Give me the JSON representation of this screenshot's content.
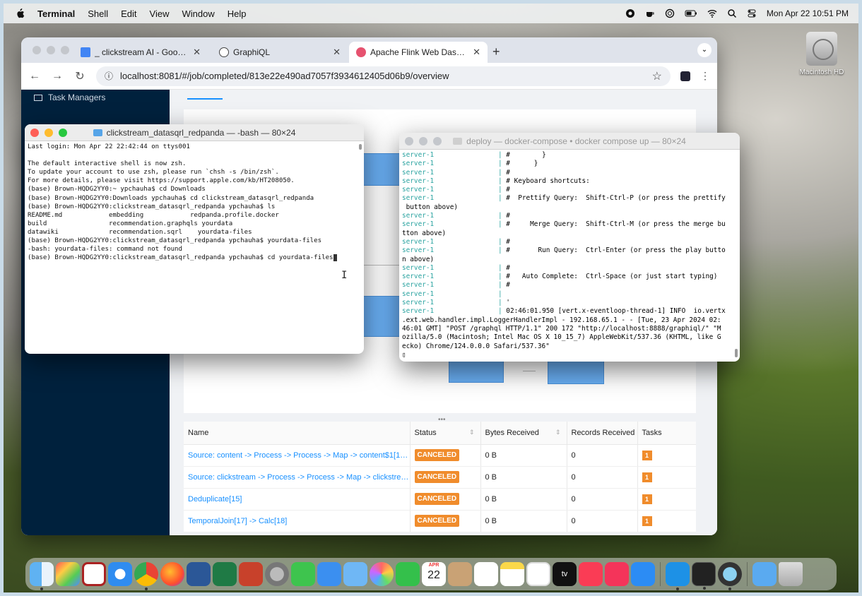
{
  "menubar": {
    "app": "Terminal",
    "items": [
      "Shell",
      "Edit",
      "View",
      "Window",
      "Help"
    ],
    "clock": "Mon Apr 22  10:51 PM"
  },
  "desktop": {
    "hd_label": "Macintosh HD"
  },
  "browser": {
    "tabs": [
      {
        "label": "_ clickstream AI - Google Do"
      },
      {
        "label": "GraphiQL"
      },
      {
        "label": "Apache Flink Web Dashboard"
      }
    ],
    "url": "localhost:8081/#/job/completed/813e22e490ad7057f3934612405d06b9/overview"
  },
  "flink": {
    "sidebar": {
      "task_managers": "Task Managers"
    },
    "table": {
      "headers": [
        "Name",
        "Status",
        "Bytes Received",
        "Records Received",
        "Tasks"
      ],
      "rows": [
        {
          "name": "Source: content -> Process -> Process -> Map -> content$1[1] ...",
          "status": "CANCELED",
          "bytes": "0 B",
          "records": "0",
          "tasks": "1"
        },
        {
          "name": "Source: clickstream -> Process -> Process -> Map -> clickstrea...",
          "status": "CANCELED",
          "bytes": "0 B",
          "records": "0",
          "tasks": "1"
        },
        {
          "name": "Deduplicate[15]",
          "status": "CANCELED",
          "bytes": "0 B",
          "records": "0",
          "tasks": "1"
        },
        {
          "name": "TemporalJoin[17] -> Calc[18]",
          "status": "CANCELED",
          "bytes": "0 B",
          "records": "0",
          "tasks": "1"
        }
      ]
    }
  },
  "terminal1": {
    "title": "clickstream_datasqrl_redpanda — -bash — 80×24",
    "lines": [
      "Last login: Mon Apr 22 22:42:44 on ttys001",
      "",
      "The default interactive shell is now zsh.",
      "To update your account to use zsh, please run `chsh -s /bin/zsh`.",
      "For more details, please visit https://support.apple.com/kb/HT208050.",
      "(base) Brown-HQDG2YY0:~ ypchauha$ cd Downloads",
      "(base) Brown-HQDG2YY0:Downloads ypchauha$ cd clickstream_datasqrl_redpanda",
      "(base) Brown-HQDG2YY0:clickstream_datasqrl_redpanda ypchauha$ ls",
      "README.md            embedding            redpanda.profile.docker",
      "build                recommendation.graphqls yourdata",
      "datawiki             recommendation.sqrl    yourdata-files",
      "(base) Brown-HQDG2YY0:clickstream_datasqrl_redpanda ypchauha$ yourdata-files",
      "-bash: yourdata-files: command not found",
      "(base) Brown-HQDG2YY0:clickstream_datasqrl_redpanda ypchauha$ cd yourdata-files"
    ]
  },
  "terminal2": {
    "title": "deploy — docker-compose • docker compose up — 80×24",
    "rows": [
      {
        "srv": "server-1",
        "text": "#        }"
      },
      {
        "srv": "server-1",
        "text": "#      }"
      },
      {
        "srv": "server-1",
        "text": "#"
      },
      {
        "srv": "server-1",
        "text": "# Keyboard shortcuts:"
      },
      {
        "srv": "server-1",
        "text": "#"
      },
      {
        "srv": "server-1",
        "text": "#  Prettify Query:  Shift-Ctrl-P (or press the prettify"
      },
      {
        "srv": "",
        "text": " button above)"
      },
      {
        "srv": "server-1",
        "text": "#"
      },
      {
        "srv": "server-1",
        "text": "#     Merge Query:  Shift-Ctrl-M (or press the merge bu"
      },
      {
        "srv": "",
        "text": "tton above)"
      },
      {
        "srv": "server-1",
        "text": "#"
      },
      {
        "srv": "server-1",
        "text": "#       Run Query:  Ctrl-Enter (or press the play butto"
      },
      {
        "srv": "",
        "text": "n above)"
      },
      {
        "srv": "server-1",
        "text": "#"
      },
      {
        "srv": "server-1",
        "text": "#   Auto Complete:  Ctrl-Space (or just start typing)"
      },
      {
        "srv": "server-1",
        "text": "#"
      },
      {
        "srv": "server-1",
        "text": ""
      },
      {
        "srv": "server-1",
        "text": "'"
      },
      {
        "srv": "server-1",
        "text": "02:46:01.950 [vert.x-eventloop-thread-1] INFO  io.vertx"
      }
    ],
    "tail": [
      ".ext.web.handler.impl.LoggerHandlerImpl - 192.168.65.1 - - [Tue, 23 Apr 2024 02:",
      "46:01 GMT] \"POST /graphql HTTP/1.1\" 200 172 \"http://localhost:8888/graphiql/\" \"M",
      "ozilla/5.0 (Macintosh; Intel Mac OS X 10_15_7) AppleWebKit/537.36 (KHTML, like G",
      "ecko) Chrome/124.0.0.0 Safari/537.36\""
    ]
  },
  "dock": {
    "calendar_month": "APR",
    "calendar_day": "22",
    "tv_label": "tv"
  }
}
